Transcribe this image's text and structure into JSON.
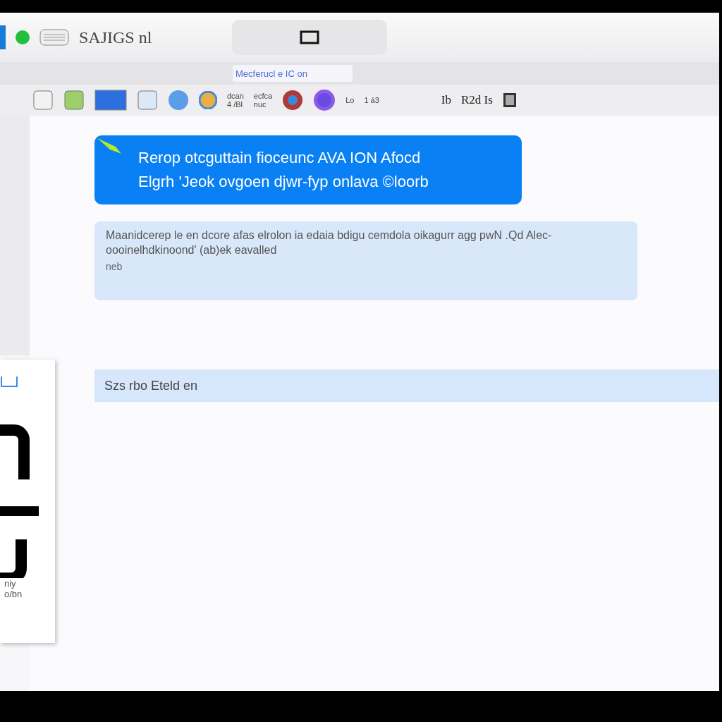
{
  "window": {
    "title": "SAJIGS nl"
  },
  "address_bar": {
    "value": "Mecferucl e IC on"
  },
  "toolbar": {
    "labels_left": [
      "dcan\n4 /Bl",
      "ecfca\nnuc"
    ],
    "labels_right": [
      "Lo",
      "1 á3"
    ],
    "labels_far": [
      "Ib",
      "R2d Is"
    ]
  },
  "message": {
    "lines": [
      "Rerop otcguttain fioceunc AVA ION Afocd",
      "Elgrh 'Jeok ovgoen djwr-fyp onlava ©loorb"
    ]
  },
  "card": {
    "text": "Maanidcerep le en dcore afas elrolon ia edaia bdigu cemdola oikagurr agg pwN .Qd Alec-oooinelhdkinoond' (ab)ek eavalled",
    "note": "neb"
  },
  "bar": {
    "text": "Szs rbo Eteld en"
  },
  "floating_card": {
    "lines": [
      "niy",
      "o/bn"
    ]
  }
}
